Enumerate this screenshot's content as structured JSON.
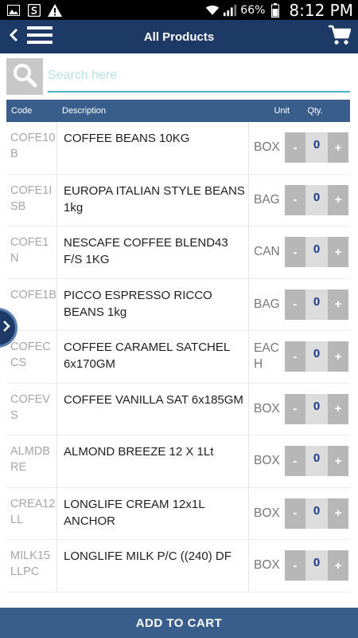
{
  "status_bar": {
    "battery": "66%",
    "time": "8:12 PM"
  },
  "header": {
    "title": "All Products"
  },
  "search": {
    "placeholder": "Search here",
    "value": ""
  },
  "table": {
    "columns": {
      "code": "Code",
      "description": "Description",
      "unit": "Unit",
      "qty": "Qty."
    },
    "rows": [
      {
        "code": "COFE10B",
        "description": "COFFEE BEANS 10KG",
        "unit": "BOX",
        "qty": "0"
      },
      {
        "code": "COFE1ISB",
        "description": "EUROPA ITALIAN STYLE BEANS 1kg",
        "unit": "BAG",
        "qty": "0"
      },
      {
        "code": "COFE1N",
        "description": "NESCAFE COFFEE BLEND43 F/S 1KG",
        "unit": "CAN",
        "qty": "0"
      },
      {
        "code": "COFE1B",
        "description": "PICCO ESPRESSO RICCO BEANS 1kg",
        "unit": "BAG",
        "qty": "0"
      },
      {
        "code": "COFECCS",
        "description": "COFFEE CARAMEL SATCHEL 6x170GM",
        "unit": "EACH",
        "qty": "0"
      },
      {
        "code": "COFEVS",
        "description": "COFFEE VANILLA SAT 6x185GM",
        "unit": "BOX",
        "qty": "0"
      },
      {
        "code": "ALMDBRE",
        "description": "ALMOND BREEZE 12 X 1Lt",
        "unit": "BOX",
        "qty": "0"
      },
      {
        "code": "CREA12LL",
        "description": "LONGLIFE CREAM 12x1L ANCHOR",
        "unit": "BOX",
        "qty": "0"
      },
      {
        "code": "MILK15LLPC",
        "description": "LONGLIFE MILK P/C ((240) DF",
        "unit": "BOX",
        "qty": "0"
      }
    ],
    "minus_label": "-",
    "plus_label": "+"
  },
  "footer": {
    "add_to_cart": "ADD TO CART"
  },
  "colors": {
    "header_bg": "#1d3a66",
    "table_header_bg": "#3a5e8c",
    "search_underline": "#49b4c4",
    "qty_value": "#1d3a8a"
  },
  "icons": {
    "status": [
      "image-icon",
      "s-app-icon",
      "warning-icon",
      "wifi-icon",
      "signal-icon",
      "battery-icon"
    ],
    "header": [
      "back-arrow-icon",
      "hamburger-menu-icon",
      "shopping-cart-icon"
    ],
    "search": "search-icon",
    "side_tab": "chevron-right-icon"
  }
}
